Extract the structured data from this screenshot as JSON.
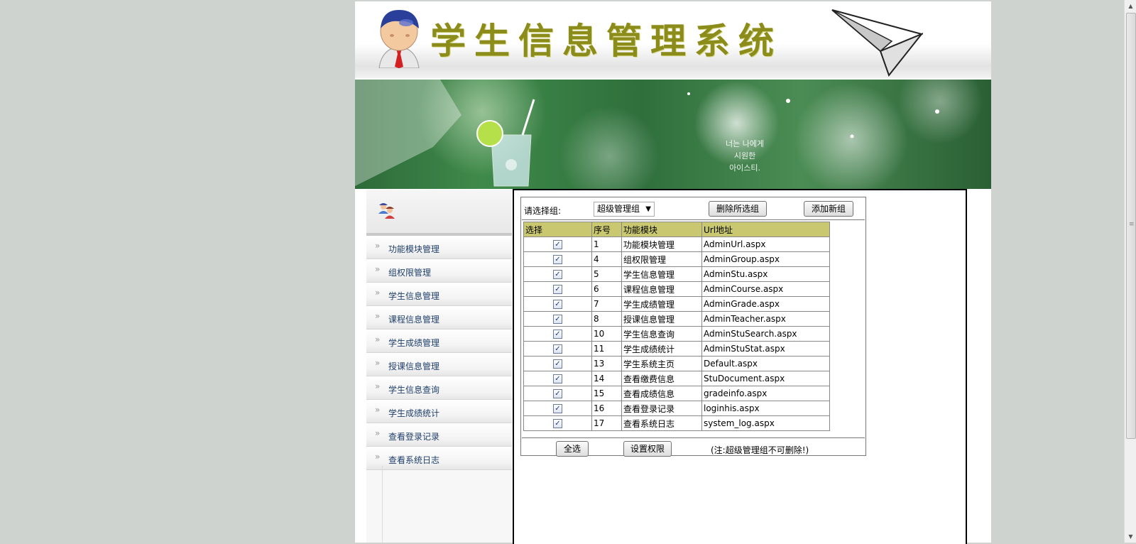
{
  "header": {
    "title": "学生信息管理系统"
  },
  "banner": {
    "text_lines": [
      "너는 나에게",
      "시원한",
      "아이스티."
    ]
  },
  "sidebar": {
    "items": [
      {
        "label": "功能模块管理"
      },
      {
        "label": "组权限管理"
      },
      {
        "label": "学生信息管理"
      },
      {
        "label": "课程信息管理"
      },
      {
        "label": "学生成绩管理"
      },
      {
        "label": "授课信息管理"
      },
      {
        "label": "学生信息查询"
      },
      {
        "label": "学生成绩统计"
      },
      {
        "label": "查看登录记录"
      },
      {
        "label": "查看系统日志"
      }
    ]
  },
  "toolbar": {
    "group_label": "请选择组:",
    "group_selected": "超级管理组",
    "delete_label": "删除所选组",
    "add_label": "添加新组"
  },
  "table": {
    "headers": [
      "选择",
      "序号",
      "功能模块",
      "Url地址"
    ],
    "rows": [
      {
        "checked": true,
        "id": "1",
        "module": "功能模块管理",
        "url": "AdminUrl.aspx"
      },
      {
        "checked": true,
        "id": "4",
        "module": "组权限管理",
        "url": "AdminGroup.aspx"
      },
      {
        "checked": true,
        "id": "5",
        "module": "学生信息管理",
        "url": "AdminStu.aspx"
      },
      {
        "checked": true,
        "id": "6",
        "module": "课程信息管理",
        "url": "AdminCourse.aspx"
      },
      {
        "checked": true,
        "id": "7",
        "module": "学生成绩管理",
        "url": "AdminGrade.aspx"
      },
      {
        "checked": true,
        "id": "8",
        "module": "授课信息管理",
        "url": "AdminTeacher.aspx"
      },
      {
        "checked": true,
        "id": "10",
        "module": "学生信息查询",
        "url": "AdminStuSearch.aspx"
      },
      {
        "checked": true,
        "id": "11",
        "module": "学生成绩统计",
        "url": "AdminStuStat.aspx"
      },
      {
        "checked": true,
        "id": "13",
        "module": "学生系统主页",
        "url": "Default.aspx"
      },
      {
        "checked": true,
        "id": "14",
        "module": "查看缴费信息",
        "url": "StuDocument.aspx"
      },
      {
        "checked": true,
        "id": "15",
        "module": "查看成绩信息",
        "url": "gradeinfo.aspx"
      },
      {
        "checked": true,
        "id": "16",
        "module": "查看登录记录",
        "url": "loginhis.aspx"
      },
      {
        "checked": true,
        "id": "17",
        "module": "查看系统日志",
        "url": "system_log.aspx"
      }
    ]
  },
  "footer": {
    "select_all_label": "全选",
    "set_permission_label": "设置权限",
    "note": "(注:超级管理组不可删除!)"
  },
  "colors": {
    "title": "#8c8c1a",
    "table_header": "#c9c870",
    "sidebar_link": "#1f3f6a"
  }
}
